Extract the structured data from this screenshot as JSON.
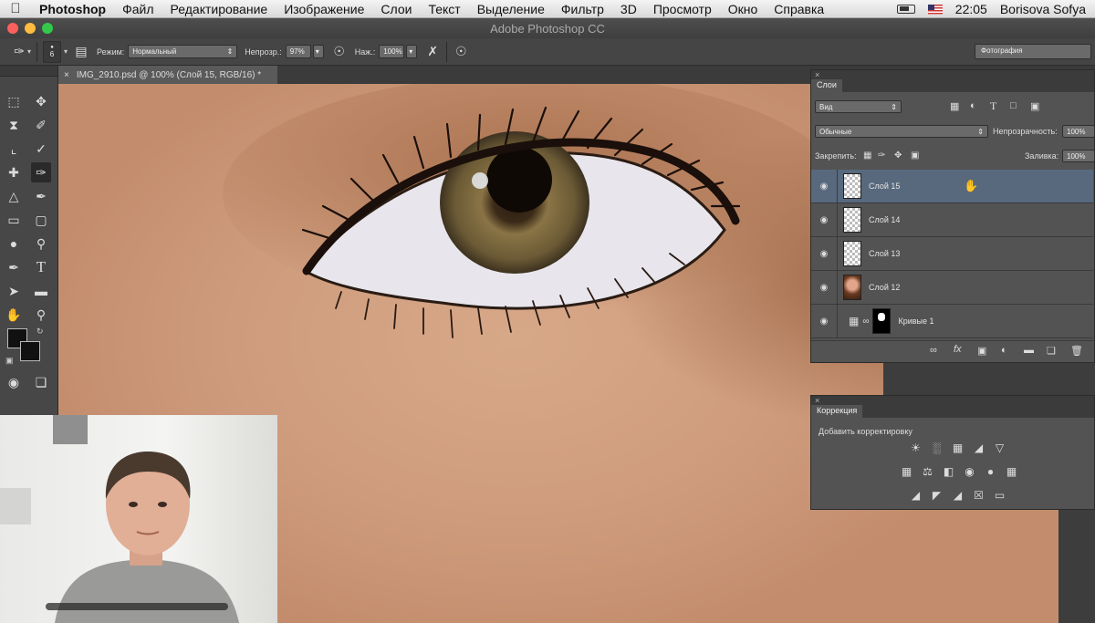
{
  "menubar": {
    "apple": "",
    "items": [
      "Photoshop",
      "Файл",
      "Редактирование",
      "Изображение",
      "Слои",
      "Текст",
      "Выделение",
      "Фильтр",
      "3D",
      "Просмотр",
      "Окно",
      "Справка"
    ],
    "time": "22:05",
    "user": "Borisova Sofya"
  },
  "window": {
    "title": "Adobe Photoshop CC"
  },
  "options": {
    "brush_size": "6",
    "mode_label": "Режим:",
    "mode_value": "Нормальный",
    "opacity_label": "Непрозр.:",
    "opacity_value": "97%",
    "pressure_label": "Наж.:",
    "pressure_value": "100%",
    "workspace": "Фотография"
  },
  "document": {
    "tab_title": "IMG_2910.psd @ 100% (Слой 15, RGB/16) *"
  },
  "layers_panel": {
    "tab": "Слои",
    "filter": "Вид",
    "blend_mode": "Обычные",
    "opacity_label": "Непрозрачность:",
    "opacity_value": "100%",
    "lock_label": "Закрепить:",
    "fill_label": "Заливка:",
    "fill_value": "100%",
    "layers": [
      {
        "name": "Слой 15",
        "selected": true
      },
      {
        "name": "Слой 14"
      },
      {
        "name": "Слой 13"
      },
      {
        "name": "Слой 12"
      },
      {
        "name": "Кривые 1"
      }
    ]
  },
  "adjustments_panel": {
    "tab": "Коррекция",
    "heading": "Добавить корректировку"
  },
  "colors": {
    "selection": "#58697d",
    "panel": "#535353",
    "skin": "#d7a888"
  }
}
